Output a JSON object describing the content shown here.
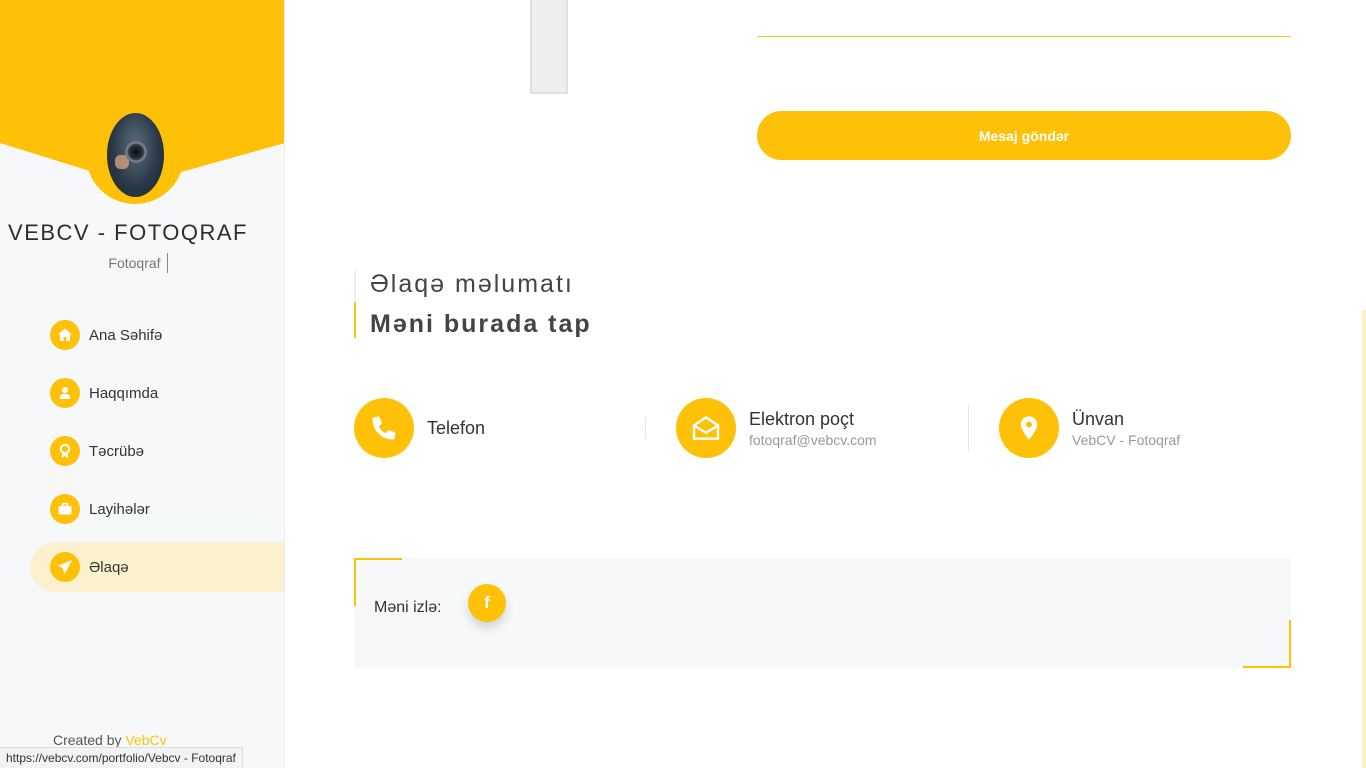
{
  "sidebar": {
    "title": "VEBCV - FOTOQRAF",
    "subtitle": "Fotoqraf",
    "items": [
      {
        "label": "Ana Səhifə",
        "icon": "home-icon"
      },
      {
        "label": "Haqqımda",
        "icon": "user-icon"
      },
      {
        "label": "Təcrübə",
        "icon": "award-icon"
      },
      {
        "label": "Layihələr",
        "icon": "briefcase-icon"
      },
      {
        "label": "Əlaqə",
        "icon": "paper-plane-icon",
        "active": true
      }
    ],
    "created_prefix": "Created by",
    "created_link": "VebCv"
  },
  "status_bar": {
    "url": "https://vebcv.com/portfolio/Vebcv - Fotoqraf"
  },
  "form": {
    "send_label": "Mesaj göndər"
  },
  "contact_section": {
    "subtitle": "Əlaqə məlumatı",
    "title": "Məni burada tap",
    "items": [
      {
        "title": "Telefon",
        "value": "",
        "icon": "phone-icon"
      },
      {
        "title": "Elektron poçt",
        "value": "fotoqraf@vebcv.com",
        "icon": "envelope-open-icon"
      },
      {
        "title": "Ünvan",
        "value": "VebCV - Fotoqraf",
        "icon": "map-pin-icon"
      }
    ]
  },
  "follow": {
    "label": "Məni izlə:",
    "facebook_glyph": "f"
  },
  "colors": {
    "accent": "#ffc107",
    "sidebar_bg": "#f7f8fa",
    "active_bg": "#fcf1cf"
  }
}
